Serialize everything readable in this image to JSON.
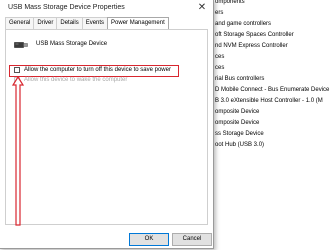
{
  "dialog": {
    "title": "USB Mass Storage Device Properties",
    "close_glyph": "✕",
    "tabs": [
      {
        "label": "General",
        "active": false
      },
      {
        "label": "Driver",
        "active": false
      },
      {
        "label": "Details",
        "active": false
      },
      {
        "label": "Events",
        "active": false
      },
      {
        "label": "Power Management",
        "active": true
      }
    ],
    "device_name": "USB Mass Storage Device",
    "device_icon": "usb-drive-icon",
    "options": [
      {
        "label": "Allow the computer to turn off this device to save power",
        "checked": false,
        "enabled": true
      },
      {
        "label": "Allow this device to wake the computer",
        "checked": false,
        "enabled": false
      }
    ],
    "buttons": {
      "ok": "OK",
      "cancel": "Cancel"
    },
    "highlight_color": "#d8262f"
  },
  "device_manager_list": [
    "omponents",
    "ers",
    "and game controllers",
    "oft Storage Spaces Controller",
    "nd NVM Express Controller",
    "ces",
    "ces",
    "rial Bus controllers",
    "D Mobile Connect - Bus Enumerate Device",
    "B 3.0 eXtensible Host Controller - 1.0 (M",
    "omposite Device",
    "omposite Device",
    "ss Storage Device",
    "oot Hub (USB 3.0)"
  ]
}
